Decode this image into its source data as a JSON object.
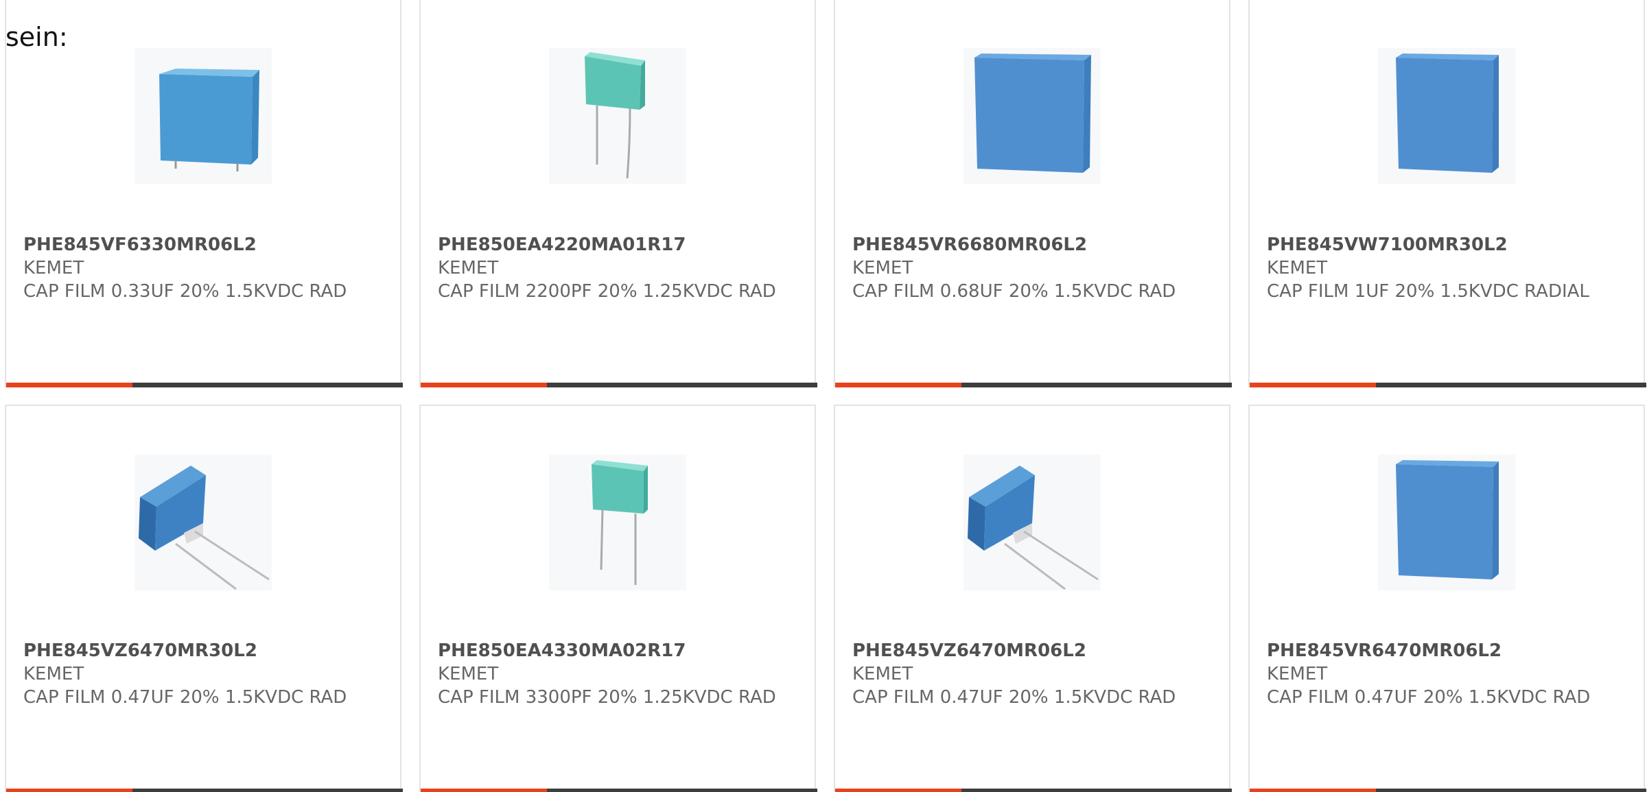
{
  "intro_text": "sein:",
  "colors": {
    "accent": "#e8431d",
    "bar": "#3d3d3d",
    "border": "#e3e3e3",
    "capacitor_blue": "#3f86c9",
    "capacitor_teal": "#5cc4b4"
  },
  "products": [
    {
      "part_number": "PHE845VF6330MR06L2",
      "manufacturer": "KEMET",
      "description": "CAP FILM 0.33UF 20% 1.5KVDC RAD",
      "image_icon": "capacitor-box-icon"
    },
    {
      "part_number": "PHE850EA4220MA01R17",
      "manufacturer": "KEMET",
      "description": "CAP FILM 2200PF 20% 1.25KVDC RAD",
      "image_icon": "capacitor-teal-leads-icon"
    },
    {
      "part_number": "PHE845VR6680MR06L2",
      "manufacturer": "KEMET",
      "description": "CAP FILM 0.68UF 20% 1.5KVDC RAD",
      "image_icon": "capacitor-box-icon"
    },
    {
      "part_number": "PHE845VW7100MR30L2",
      "manufacturer": "KEMET",
      "description": "CAP FILM 1UF 20% 1.5KVDC RADIAL",
      "image_icon": "capacitor-box-icon"
    },
    {
      "part_number": "PHE845VZ6470MR30L2",
      "manufacturer": "KEMET",
      "description": "CAP FILM 0.47UF 20% 1.5KVDC RAD",
      "image_icon": "capacitor-angled-icon"
    },
    {
      "part_number": "PHE850EA4330MA02R17",
      "manufacturer": "KEMET",
      "description": "CAP FILM 3300PF 20% 1.25KVDC RAD",
      "image_icon": "capacitor-teal-leads-icon"
    },
    {
      "part_number": "PHE845VZ6470MR06L2",
      "manufacturer": "KEMET",
      "description": "CAP FILM 0.47UF 20% 1.5KVDC RAD",
      "image_icon": "capacitor-angled-icon"
    },
    {
      "part_number": "PHE845VR6470MR06L2",
      "manufacturer": "KEMET",
      "description": "CAP FILM 0.47UF 20% 1.5KVDC RAD",
      "image_icon": "capacitor-box-icon"
    }
  ]
}
